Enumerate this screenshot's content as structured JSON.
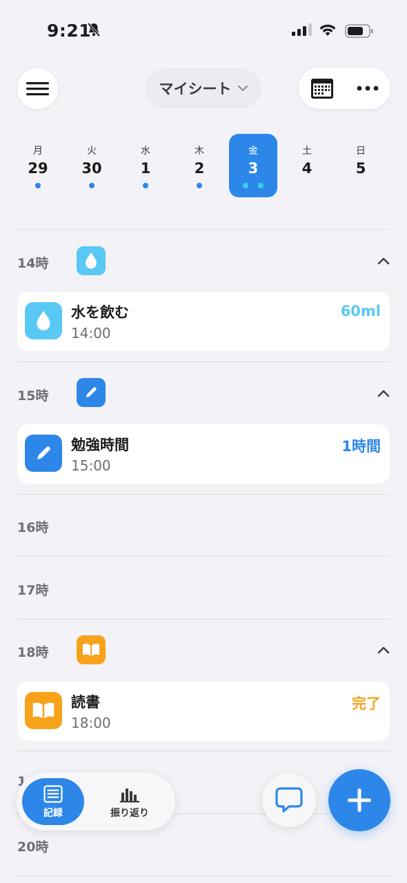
{
  "status_bar": {
    "time": "9:21"
  },
  "header": {
    "sheet_name": "マイシート"
  },
  "week": [
    {
      "weekday": "月",
      "date": "29",
      "dots": 1,
      "selected": false
    },
    {
      "weekday": "火",
      "date": "30",
      "dots": 1,
      "selected": false
    },
    {
      "weekday": "水",
      "date": "1",
      "dots": 1,
      "selected": false
    },
    {
      "weekday": "木",
      "date": "2",
      "dots": 1,
      "selected": false
    },
    {
      "weekday": "金",
      "date": "3",
      "dots": 2,
      "selected": true
    },
    {
      "weekday": "土",
      "date": "4",
      "dots": 0,
      "selected": false
    },
    {
      "weekday": "日",
      "date": "5",
      "dots": 0,
      "selected": false
    }
  ],
  "timeline": {
    "h14": {
      "label": "14時"
    },
    "h15": {
      "label": "15時"
    },
    "h16": {
      "label": "16時"
    },
    "h17": {
      "label": "17時"
    },
    "h18": {
      "label": "18時"
    },
    "h19": {
      "label": "1"
    },
    "h20": {
      "label": "20時"
    }
  },
  "records": {
    "water": {
      "title": "水を飲む",
      "time": "14:00",
      "value": "60ml",
      "color": "#5ac8f5",
      "icon": "water-drop-icon"
    },
    "study": {
      "title": "勉強時間",
      "time": "15:00",
      "value": "1時間",
      "color": "#2d87e8",
      "icon": "pencil-icon"
    },
    "reading": {
      "title": "読書",
      "time": "18:00",
      "value": "完了",
      "color": "#f7a21b",
      "icon": "book-icon"
    }
  },
  "tabbar": {
    "record_label": "記録",
    "review_label": "振り返り"
  },
  "colors": {
    "accent": "#2d87e8",
    "background": "#f2f2f7"
  }
}
